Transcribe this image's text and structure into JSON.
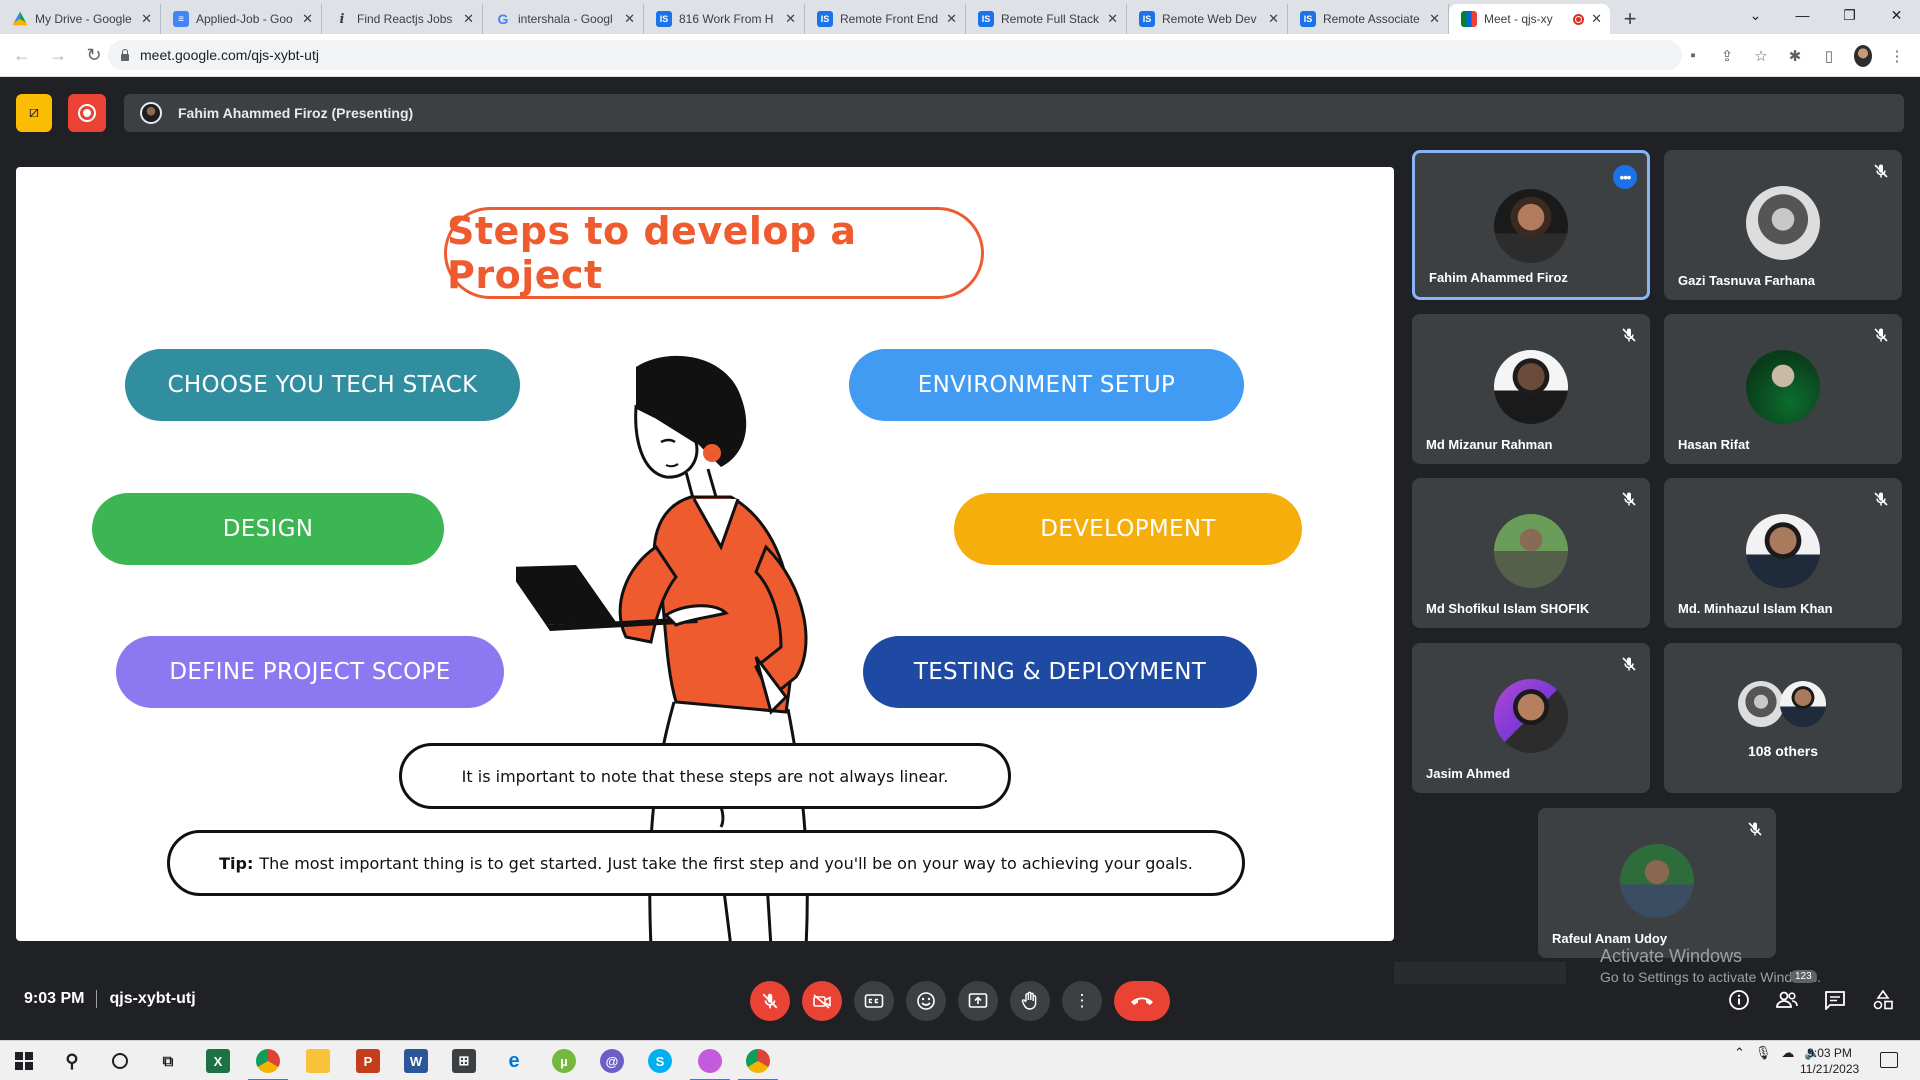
{
  "browser": {
    "tabs": [
      {
        "title": "My Drive - Google",
        "icon": "drive-icon"
      },
      {
        "title": "Applied-Job - Goo",
        "icon": "docs-icon"
      },
      {
        "title": "Find Reactjs Jobs",
        "icon": "info-icon"
      },
      {
        "title": "intershala - Googl",
        "icon": "google-icon"
      },
      {
        "title": "816 Work From H",
        "icon": "is-icon"
      },
      {
        "title": "Remote Front End",
        "icon": "is-icon"
      },
      {
        "title": "Remote Full Stack",
        "icon": "is-icon"
      },
      {
        "title": "Remote Web Dev",
        "icon": "is-icon"
      },
      {
        "title": "Remote Associate",
        "icon": "is-icon"
      },
      {
        "title": "Meet - qjs-xy",
        "icon": "meet-icon"
      }
    ],
    "url": "meet.google.com/qjs-xybt-utj"
  },
  "meet": {
    "presenting_label": "Fahim Ahammed Firoz (Presenting)",
    "time": "9:03 PM",
    "meeting_code": "qjs-xybt-utj",
    "participants": [
      {
        "name": "Fahim Ahammed Firoz",
        "muted": false,
        "active": true
      },
      {
        "name": "Gazi Tasnuva Farhana",
        "muted": true
      },
      {
        "name": "Md Mizanur Rahman",
        "muted": true
      },
      {
        "name": "Hasan Rifat",
        "muted": true
      },
      {
        "name": "Md Shofikul Islam SHOFIK",
        "muted": true
      },
      {
        "name": "Md. Minhazul Islam Khan",
        "muted": true
      },
      {
        "name": "Jasim Ahmed",
        "muted": true
      },
      {
        "name": "Rafeul Anam Udoy",
        "muted": true
      }
    ],
    "others_label": "108 others",
    "people_count": "123"
  },
  "slide": {
    "title": "Steps to develop a Project",
    "steps": [
      {
        "label": "CHOOSE YOU TECH STACK",
        "color": "#318e9f"
      },
      {
        "label": "ENVIRONMENT SETUP",
        "color": "#419bf2"
      },
      {
        "label": "DESIGN",
        "color": "#3cb653"
      },
      {
        "label": "DEVELOPMENT",
        "color": "#f6ae0c"
      },
      {
        "label": "DEFINE PROJECT SCOPE",
        "color": "#8c79f2"
      },
      {
        "label": "TESTING & DEPLOYMENT",
        "color": "#1f4aa4"
      }
    ],
    "note": "It is important to note that these steps are not always linear.",
    "tip_label": "Tip:",
    "tip_text": "The most important thing is to get started. Just take the first step and you'll be on your way to achieving your goals."
  },
  "watermark": {
    "line1": "Activate Windows",
    "line2": "Go to Settings to activate Windows."
  },
  "system": {
    "time": "9:03 PM",
    "date": "11/21/2023"
  }
}
